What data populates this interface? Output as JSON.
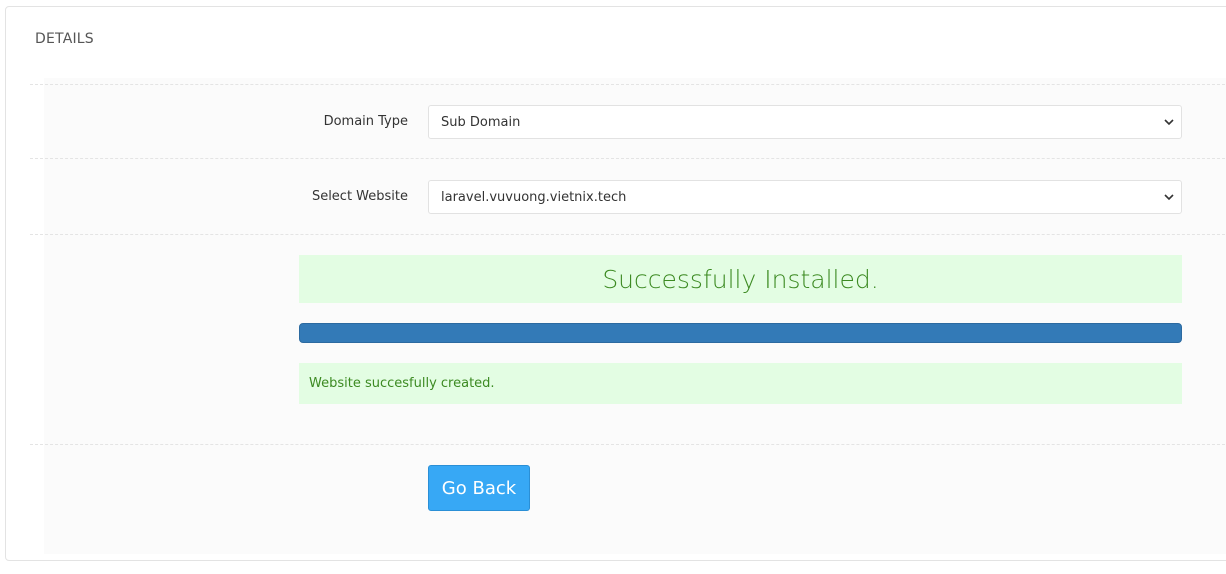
{
  "panel": {
    "title": "DETAILS"
  },
  "form": {
    "domain_type": {
      "label": "Domain Type",
      "selected": "Sub Domain"
    },
    "select_website": {
      "label": "Select Website",
      "selected": "laravel.vuvuong.vietnix.tech"
    }
  },
  "status": {
    "title": "Successfully Installed.",
    "progress": 1.0,
    "message": "Website succesfully created."
  },
  "actions": {
    "go_back_label": "Go Back"
  },
  "colors": {
    "success_bg": "#e3fde3",
    "success_text": "#3c8a22",
    "progress_bar": "#337ab7",
    "button_bg": "#37a8f5"
  }
}
